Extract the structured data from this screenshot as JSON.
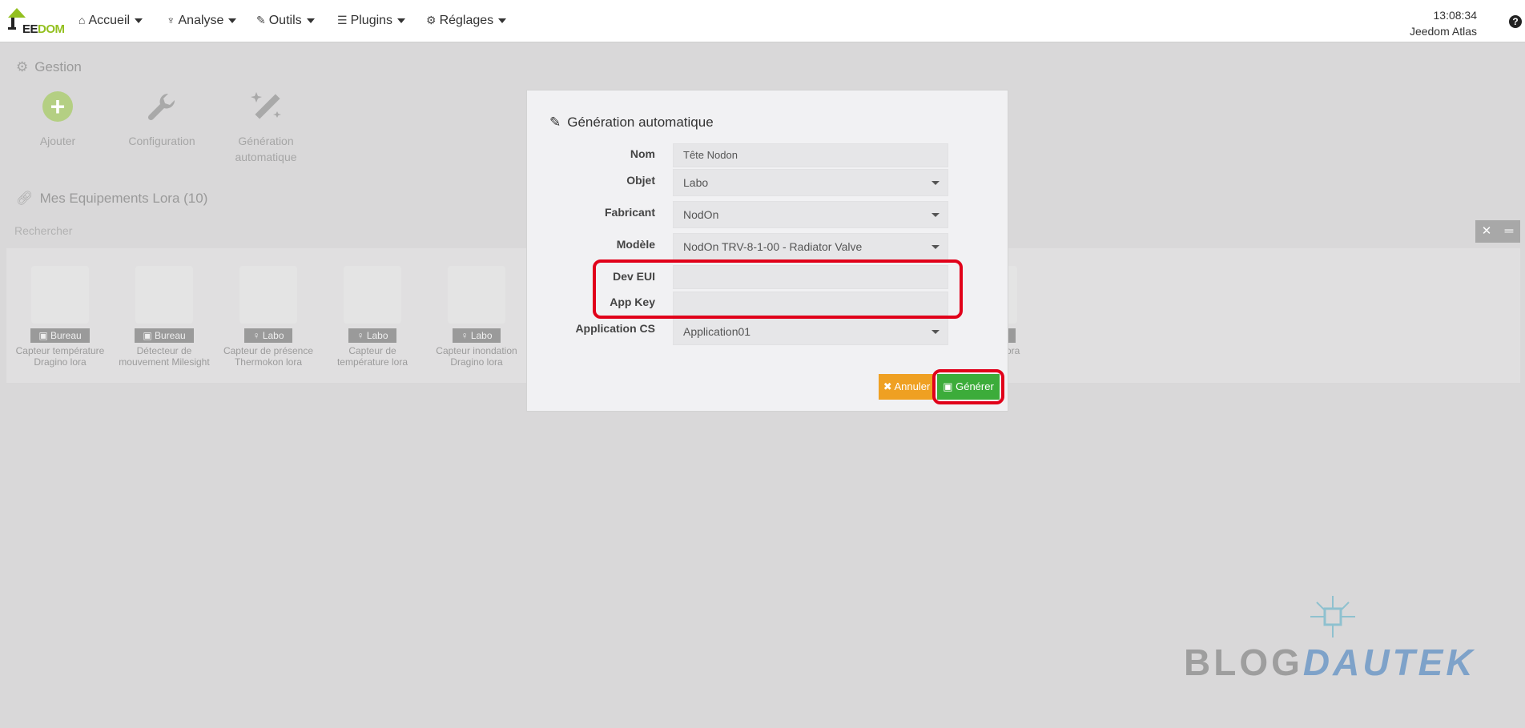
{
  "navbar": {
    "logo_text_left": "EE",
    "logo_text_right": "DOM",
    "menus": [
      {
        "label": "Accueil",
        "icon": "home-icon"
      },
      {
        "label": "Analyse",
        "icon": "stethoscope-icon"
      },
      {
        "label": "Outils",
        "icon": "wrench-icon"
      },
      {
        "label": "Plugins",
        "icon": "list-icon"
      },
      {
        "label": "Réglages",
        "icon": "gear-icon"
      }
    ],
    "time": "13:08:34",
    "system_name": "Jeedom Atlas",
    "help": "?"
  },
  "gestion": {
    "title": "Gestion",
    "cards": [
      {
        "label_line1": "Ajouter",
        "label_line2": "",
        "icon": "plus-circle-icon"
      },
      {
        "label_line1": "Configuration",
        "label_line2": "",
        "icon": "wrench-icon"
      },
      {
        "label_line1": "Génération",
        "label_line2": "automatique",
        "icon": "magic-wand-icon"
      }
    ]
  },
  "equipements": {
    "title": "Mes Equipements Lora (10)",
    "search_placeholder": "Rechercher",
    "clear_icon": "✕",
    "layout_icon": "═",
    "items": [
      {
        "room": "Bureau",
        "name_line1": "Capteur température",
        "name_line2": "Dragino lora"
      },
      {
        "room": "Bureau",
        "name_line1": "Détecteur de",
        "name_line2": "mouvement Milesight"
      },
      {
        "room": "Labo",
        "name_line1": "Capteur de présence",
        "name_line2": "Thermokon lora"
      },
      {
        "room": "Labo",
        "name_line1": "Capteur de",
        "name_line2": "température lora"
      },
      {
        "room": "Labo",
        "name_line1": "Capteur inondation",
        "name_line2": "Dragino lora"
      }
    ],
    "partial_badge": "o",
    "partial_name": "no lora"
  },
  "modal": {
    "title": "Génération automatique",
    "fields": {
      "nom": {
        "label": "Nom",
        "value": "Tête Nodon"
      },
      "objet": {
        "label": "Objet",
        "value": "Labo"
      },
      "fabricant": {
        "label": "Fabricant",
        "value": "NodOn"
      },
      "modele": {
        "label": "Modèle",
        "value": "NodOn TRV-8-1-00 - Radiator Valve"
      },
      "dev_eui": {
        "label": "Dev EUI",
        "value": ""
      },
      "app_key": {
        "label": "App Key",
        "value": ""
      },
      "application": {
        "label": "Application CS",
        "value": "Application01"
      }
    },
    "cancel_label": "Annuler",
    "generate_label": "Générer",
    "highlight_color": "#e1001a"
  },
  "watermark": {
    "part1": "BLOG",
    "part2": "DAUTEK"
  }
}
